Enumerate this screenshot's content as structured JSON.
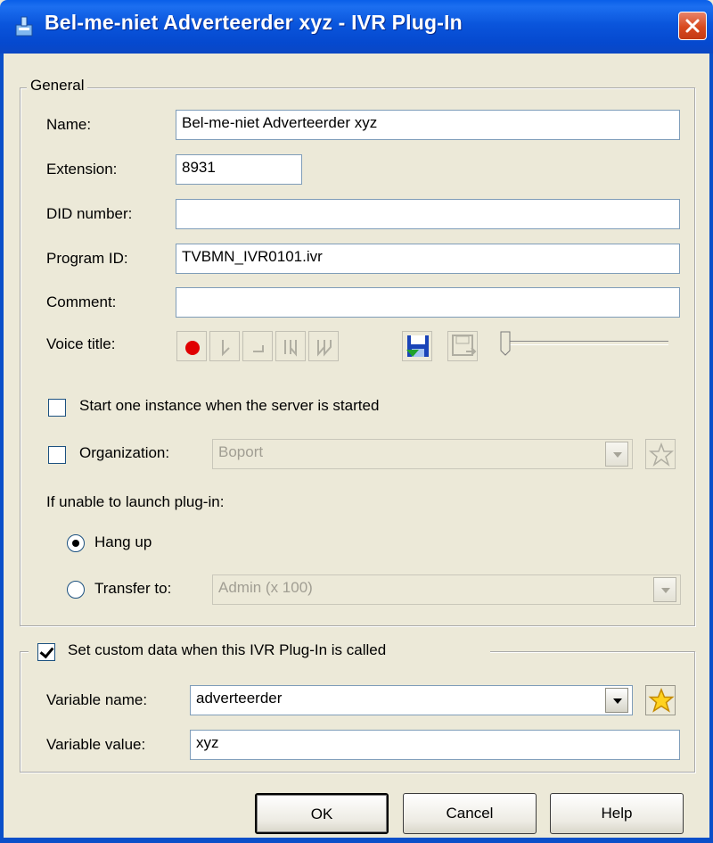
{
  "window": {
    "title": "Bel-me-niet Adverteerder xyz - IVR Plug-In"
  },
  "general": {
    "legend": "General",
    "name_label": "Name:",
    "name_value": "Bel-me-niet Adverteerder xyz",
    "extension_label": "Extension:",
    "extension_value": "8931",
    "did_label": "DID number:",
    "did_value": "",
    "program_id_label": "Program ID:",
    "program_id_value": "TVBMN_IVR0101.ivr",
    "comment_label": "Comment:",
    "comment_value": "",
    "voice_title_label": "Voice title:",
    "voice_buttons": [
      "record-icon",
      "play-icon",
      "stop-icon",
      "rewind-icon",
      "fast-forward-icon",
      "save-icon",
      "load-icon"
    ],
    "start_instance_label": "Start one instance when the server is started",
    "start_instance_checked": false,
    "organization_label": "Organization:",
    "organization_checked": false,
    "organization_value": "Boport",
    "unable_label": "If unable to launch plug-in:",
    "hang_up_label": "Hang up",
    "hang_up_selected": true,
    "transfer_label": "Transfer to:",
    "transfer_selected": false,
    "transfer_value": "Admin (x 100)"
  },
  "custom": {
    "legend": "Set custom data when this IVR Plug-In is called",
    "checked": true,
    "variable_name_label": "Variable name:",
    "variable_name_value": "adverteerder",
    "variable_value_label": "Variable value:",
    "variable_value_value": "xyz"
  },
  "buttons": {
    "ok": "OK",
    "cancel": "Cancel",
    "help": "Help"
  },
  "colors": {
    "titlebar": "#0A55DC",
    "face": "#ECE9D8",
    "close": "#D8491E",
    "record": "#E00000"
  }
}
